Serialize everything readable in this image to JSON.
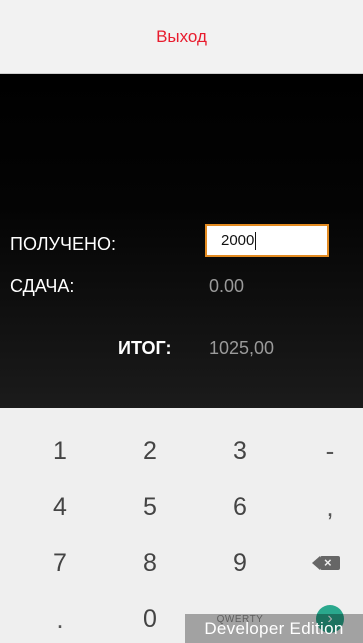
{
  "header": {
    "exit_label": "Выход"
  },
  "payment": {
    "received_label": "ПОЛУЧЕНО:",
    "received_value": "2000",
    "change_label": "СДАЧА:",
    "change_value": "0.00",
    "total_label": "ИТОГ:",
    "total_value": "1025,00"
  },
  "keypad": {
    "rows": [
      [
        "1",
        "2",
        "3",
        "-"
      ],
      [
        "4",
        "5",
        "6",
        ","
      ],
      [
        "7",
        "8",
        "9",
        "⌫"
      ],
      [
        ".",
        "0",
        "QWERTY",
        "→"
      ]
    ],
    "backspace_icon": "backspace-icon",
    "enter_icon": "arrow-right-icon",
    "qwerty_label": "QWERTY"
  },
  "watermark": "Developer Edition"
}
